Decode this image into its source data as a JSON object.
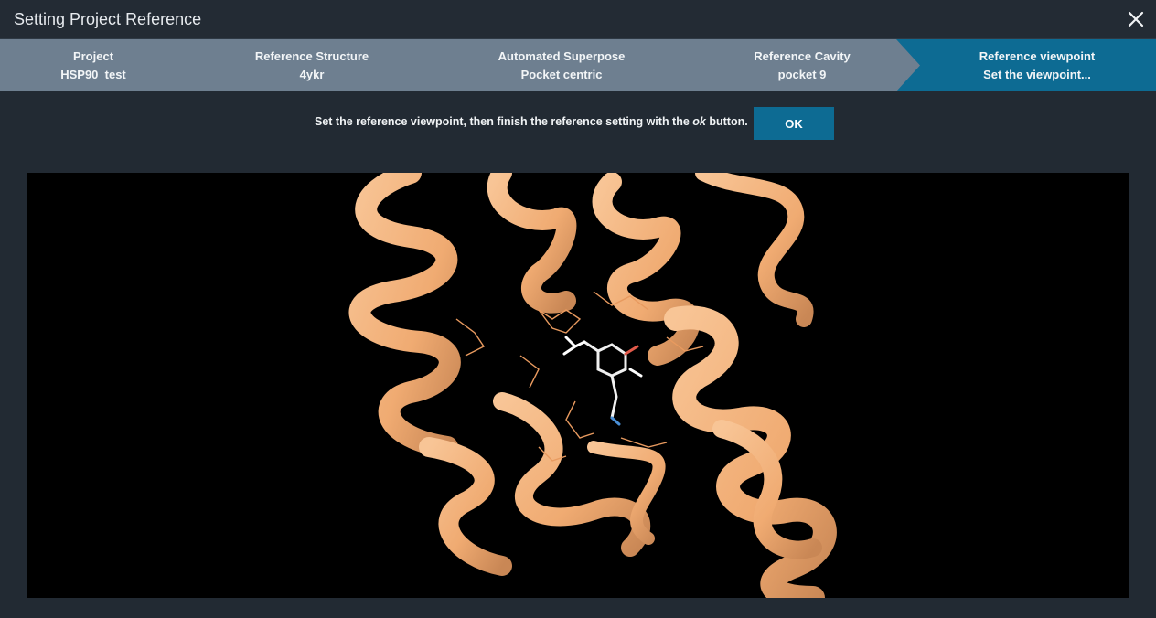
{
  "window": {
    "title": "Setting Project Reference",
    "close_icon": "close-icon"
  },
  "steps": [
    {
      "label": "Project",
      "value": "HSP90_test"
    },
    {
      "label": "Reference Structure",
      "value": "4ykr"
    },
    {
      "label": "Automated Superpose",
      "value": "Pocket centric"
    },
    {
      "label": "Reference Cavity",
      "value": "pocket 9"
    },
    {
      "label": "Reference viewpoint",
      "value": "Set the viewpoint..."
    }
  ],
  "active_step_index": 4,
  "instruction": {
    "before": "Set the reference viewpoint, then finish the reference setting with the ",
    "emphasis": "ok",
    "after": " button."
  },
  "ok_label": "OK",
  "colors": {
    "background": "#222a33",
    "step_bar": "#6e7f90",
    "active_step": "#0d6b93",
    "accent": "#0d6b93",
    "ribbon": "#f5b784"
  }
}
